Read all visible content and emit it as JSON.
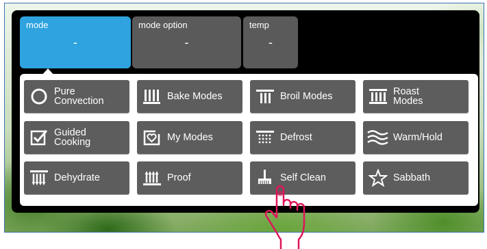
{
  "tabs": [
    {
      "label": "mode",
      "value": "-",
      "active": true
    },
    {
      "label": "mode option",
      "value": "-"
    },
    {
      "label": "temp",
      "value": "-"
    }
  ],
  "modes": [
    {
      "label": "Pure\nConvection",
      "icon": "circle-icon"
    },
    {
      "label": "Bake Modes",
      "icon": "bake-icon"
    },
    {
      "label": "Broil Modes",
      "icon": "broil-icon"
    },
    {
      "label": "Roast\nModes",
      "icon": "roast-icon"
    },
    {
      "label": "Guided\nCooking",
      "icon": "guided-cooking-icon"
    },
    {
      "label": "My Modes",
      "icon": "heart-icon"
    },
    {
      "label": "Defrost",
      "icon": "defrost-icon"
    },
    {
      "label": "Warm/Hold",
      "icon": "warm-hold-icon"
    },
    {
      "label": "Dehydrate",
      "icon": "dehydrate-icon"
    },
    {
      "label": "Proof",
      "icon": "proof-icon"
    },
    {
      "label": "Self Clean",
      "icon": "self-clean-icon"
    },
    {
      "label": "Sabbath",
      "icon": "star-icon"
    }
  ],
  "colors": {
    "accent": "#2ea3e0",
    "button": "#5d5d5d",
    "panel": "#000000",
    "pointer": "#e0145a"
  }
}
